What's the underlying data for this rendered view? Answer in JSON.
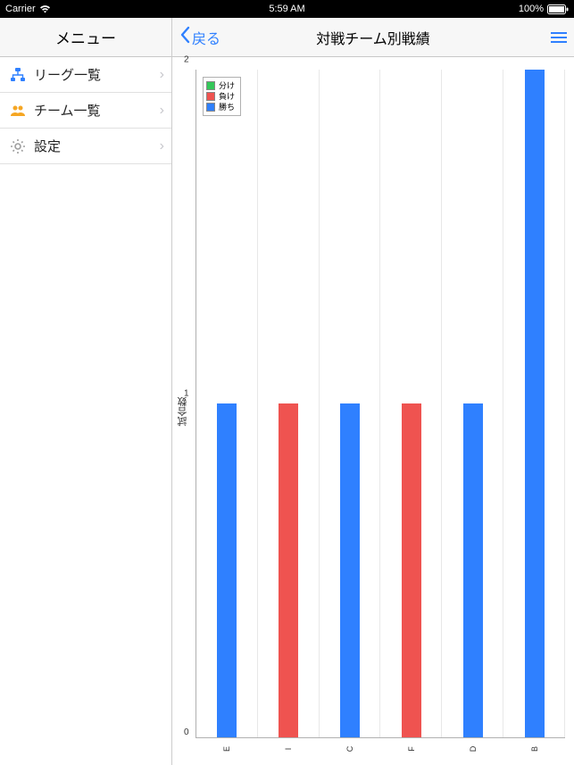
{
  "status": {
    "carrier": "Carrier",
    "time": "5:59 AM",
    "battery_pct": "100%"
  },
  "sidebar": {
    "title": "メニュー",
    "items": [
      {
        "label": "リーグ一覧",
        "icon": "sitemap"
      },
      {
        "label": "チーム一覧",
        "icon": "people"
      },
      {
        "label": "設定",
        "icon": "gear"
      }
    ]
  },
  "main": {
    "back_label": "戻る",
    "title": "対戦チーム別戦績"
  },
  "chart_data": {
    "type": "bar",
    "ylabel": "試合数",
    "ylim": [
      0,
      2
    ],
    "yticks": [
      0,
      1,
      2
    ],
    "categories": [
      "E",
      "I",
      "C",
      "F",
      "D",
      "B"
    ],
    "series": [
      {
        "name": "分け",
        "color": "#34c759",
        "values": [
          0,
          0,
          0,
          0,
          0,
          0
        ]
      },
      {
        "name": "負け",
        "color": "#ef5350",
        "values": [
          0,
          1,
          0,
          1,
          0,
          0
        ]
      },
      {
        "name": "勝ち",
        "color": "#2f80ff",
        "values": [
          1,
          0,
          1,
          0,
          1,
          2
        ]
      }
    ],
    "legend_position": "upper-left"
  }
}
